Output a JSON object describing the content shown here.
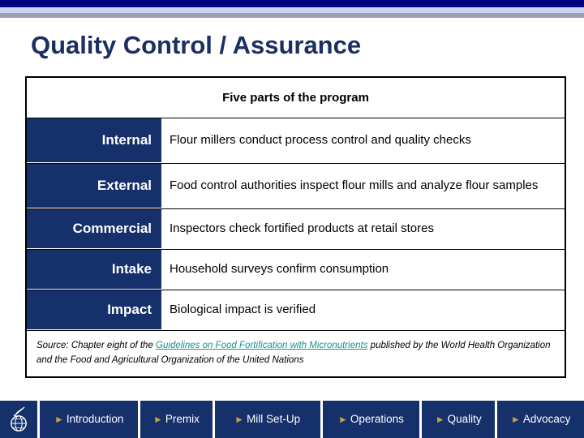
{
  "decor": {
    "navy_bar_color": "#000080",
    "lavender_bar_color": "#C9D3EF",
    "gray_bar_color": "#9AA0B0"
  },
  "slide": {
    "title": "Quality Control / Assurance",
    "title_color": "#1B2F63"
  },
  "table": {
    "header_title": "Five parts of the program",
    "label_cell_color": "#16306B",
    "rows": [
      {
        "label": "Internal",
        "description": "Flour millers conduct process control and quality checks"
      },
      {
        "label": "External",
        "description": "Food control authorities inspect flour mills and analyze flour samples"
      },
      {
        "label": "Commercial",
        "description": "Inspectors check fortified products at retail stores"
      },
      {
        "label": "Intake",
        "description": "Household surveys confirm consumption"
      },
      {
        "label": "Impact",
        "description": "Biological impact is verified"
      }
    ],
    "source": {
      "prefix": "Source: Chapter eight of the ",
      "link_text": "Guidelines on Food Fortification with Micronutrients",
      "suffix": " published by the World Health Organization and the Food and Agricultural Organization of the United Nations",
      "link_color": "#1A8F8F"
    }
  },
  "bottom_nav": {
    "logo_icon": "globe-wheat-logo-icon",
    "arrow_glyph": "►",
    "arrow_color": "#C8A13C",
    "background_color": "#16306B",
    "buttons": [
      {
        "label": "Introduction"
      },
      {
        "label": "Premix"
      },
      {
        "label": "Mill Set-Up"
      },
      {
        "label": "Operations"
      },
      {
        "label": "Quality"
      },
      {
        "label": "Advocacy"
      }
    ]
  }
}
